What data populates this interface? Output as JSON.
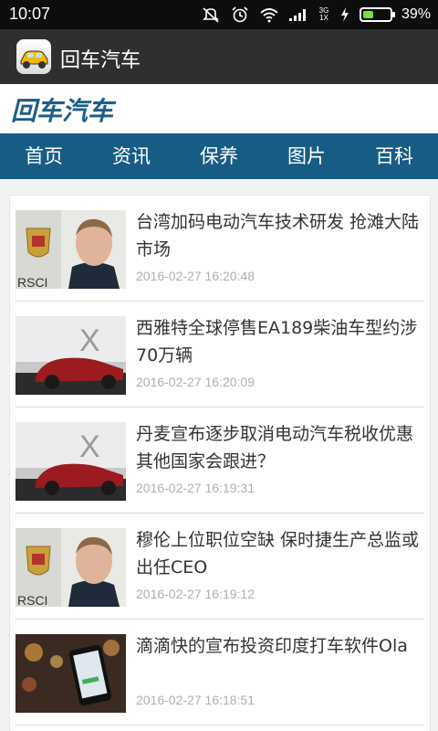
{
  "statusbar": {
    "time": "10:07",
    "net_top": "3G",
    "net_bottom": "1X",
    "battery": "39%",
    "battery_level": 0.39
  },
  "appbar": {
    "title": "回车汽车",
    "icon": "car-app-icon"
  },
  "brand": {
    "logo_text": "回车汽车"
  },
  "nav": {
    "items": [
      "首页",
      "资讯",
      "保养",
      "图片",
      "百科"
    ]
  },
  "articles": [
    {
      "title": "台湾加码电动汽车技术研发 抢滩大陆市场",
      "time": "2016-02-27 16:20:48",
      "thumb": "porsche-executive-photo"
    },
    {
      "title": "西雅特全球停售EA189柴油车型约涉70万辆",
      "time": "2016-02-27 16:20:09",
      "thumb": "red-car-photo"
    },
    {
      "title": "丹麦宣布逐步取消电动汽车税收优惠 其他国家会跟进？",
      "time": "2016-02-27 16:19:31",
      "thumb": "red-car-photo"
    },
    {
      "title": "穆伦上位职位空缺 保时捷生产总监或出任CEO",
      "time": "2016-02-27 16:19:12",
      "thumb": "porsche-executive-photo"
    },
    {
      "title": "滴滴快的宣布投资印度打车软件Ola",
      "time": "2016-02-27 16:18:51",
      "thumb": "phone-app-photo"
    }
  ]
}
